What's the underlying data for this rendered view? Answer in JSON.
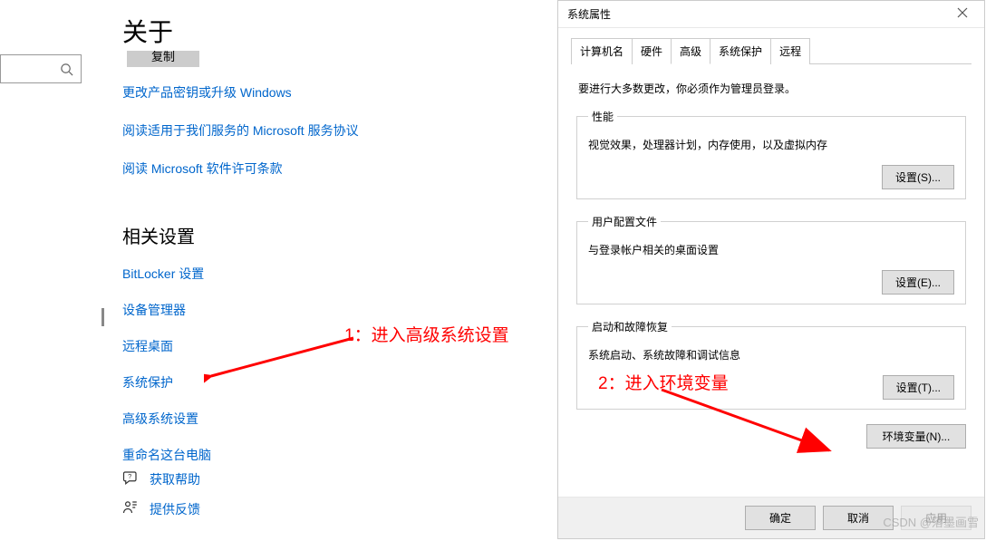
{
  "settings": {
    "title": "关于",
    "copy_btn": "复制",
    "links_top": [
      "更改产品密钥或升级 Windows",
      "阅读适用于我们服务的 Microsoft 服务协议",
      "阅读 Microsoft 软件许可条款"
    ],
    "related_heading": "相关设置",
    "related_links": [
      "BitLocker 设置",
      "设备管理器",
      "远程桌面",
      "系统保护",
      "高级系统设置",
      "重命名这台电脑"
    ],
    "help": "获取帮助",
    "feedback": "提供反馈"
  },
  "annotations": {
    "a1": "1：进入高级系统设置",
    "a2": "2：进入环境变量"
  },
  "dialog": {
    "title": "系统属性",
    "tabs": [
      "计算机名",
      "硬件",
      "高级",
      "系统保护",
      "远程"
    ],
    "active_tab": 2,
    "admin_note": "要进行大多数更改，你必须作为管理员登录。",
    "perf": {
      "legend": "性能",
      "desc": "视觉效果，处理器计划，内存使用，以及虚拟内存",
      "btn": "设置(S)..."
    },
    "profile": {
      "legend": "用户配置文件",
      "desc": "与登录帐户相关的桌面设置",
      "btn": "设置(E)..."
    },
    "startup": {
      "legend": "启动和故障恢复",
      "desc": "系统启动、系统故障和调试信息",
      "btn": "设置(T)..."
    },
    "envvar_btn": "环境变量(N)...",
    "ok": "确定",
    "cancel": "取消",
    "apply": "应用"
  },
  "watermark": "CSDN @落墨画雪"
}
